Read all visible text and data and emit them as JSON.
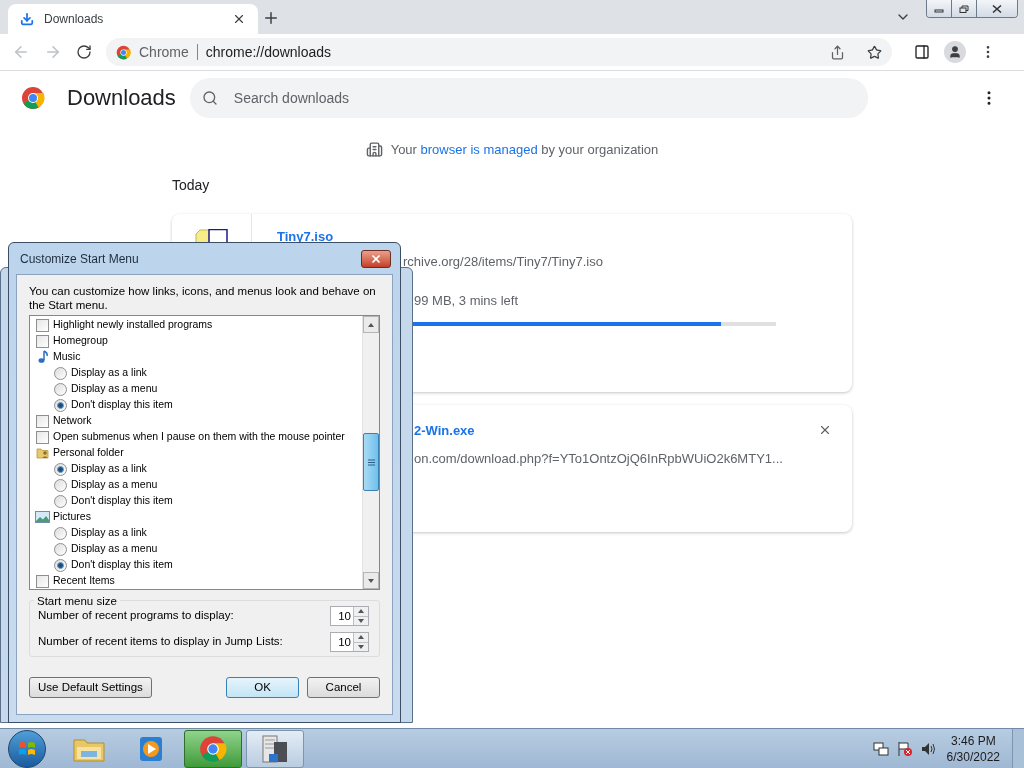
{
  "browser": {
    "tab": {
      "title": "Downloads"
    },
    "address": {
      "site_label": "Chrome",
      "url": "chrome://downloads"
    }
  },
  "page": {
    "title": "Downloads",
    "search": {
      "placeholder": "Search downloads"
    },
    "managed_notice": {
      "before": "Your",
      "link": "browser is managed",
      "after": "by your organization"
    },
    "section": "Today",
    "downloads": [
      {
        "kind": "progress",
        "name": "Tiny7.iso",
        "url": "rchive.org/28/items/Tiny7/Tiny7.iso",
        "status": "99 MB, 3 mins left",
        "level": 0.89
      },
      {
        "kind": "done",
        "name": "2-Win.exe",
        "url": "on.com/download.php?f=YTo1OntzOjQ6InRpbWUiO2k6MTY1..."
      }
    ]
  },
  "dialog": {
    "title": "Customize Start Menu",
    "description": "You can customize how links, icons, and menus look and behave on the Start menu.",
    "options": [
      {
        "kind": "checkbox",
        "label": "Highlight newly installed programs",
        "checked": false
      },
      {
        "kind": "checkbox",
        "label": "Homegroup",
        "checked": false
      },
      {
        "kind": "heading",
        "label": "Music"
      },
      {
        "kind": "radio",
        "label": "Display as a link",
        "selected": false
      },
      {
        "kind": "radio",
        "label": "Display as a menu",
        "selected": false
      },
      {
        "kind": "radio",
        "label": "Don't display this item",
        "selected": true
      },
      {
        "kind": "checkbox",
        "label": "Network",
        "checked": false
      },
      {
        "kind": "checkbox",
        "label": "Open submenus when I pause on them with the mouse pointer",
        "checked": false
      },
      {
        "kind": "heading",
        "label": "Personal folder"
      },
      {
        "kind": "radio",
        "label": "Display as a link",
        "selected": true
      },
      {
        "kind": "radio",
        "label": "Display as a menu",
        "selected": false
      },
      {
        "kind": "radio",
        "label": "Don't display this item",
        "selected": false
      },
      {
        "kind": "heading",
        "label": "Pictures"
      },
      {
        "kind": "radio",
        "label": "Display as a link",
        "selected": false
      },
      {
        "kind": "radio",
        "label": "Display as a menu",
        "selected": false
      },
      {
        "kind": "radio",
        "label": "Don't display this item",
        "selected": true
      },
      {
        "kind": "checkbox",
        "label": "Recent Items",
        "checked": false
      }
    ],
    "size_group": {
      "title": "Start menu size",
      "fields": [
        {
          "label": "Number of recent programs to display:",
          "value": "10"
        },
        {
          "label": "Number of recent items to display in Jump Lists:",
          "value": "10"
        }
      ]
    },
    "buttons": [
      {
        "label": "Use Default Settings",
        "focused": false
      },
      {
        "label": "OK",
        "focused": true
      },
      {
        "label": "Cancel",
        "focused": false
      }
    ]
  },
  "taskbar": {
    "apps": [
      {
        "active": false
      },
      {
        "active": false
      },
      {
        "active": true
      },
      {
        "active": false
      }
    ],
    "clock": {
      "time": "3:46 PM",
      "date": "6/30/2022"
    }
  }
}
